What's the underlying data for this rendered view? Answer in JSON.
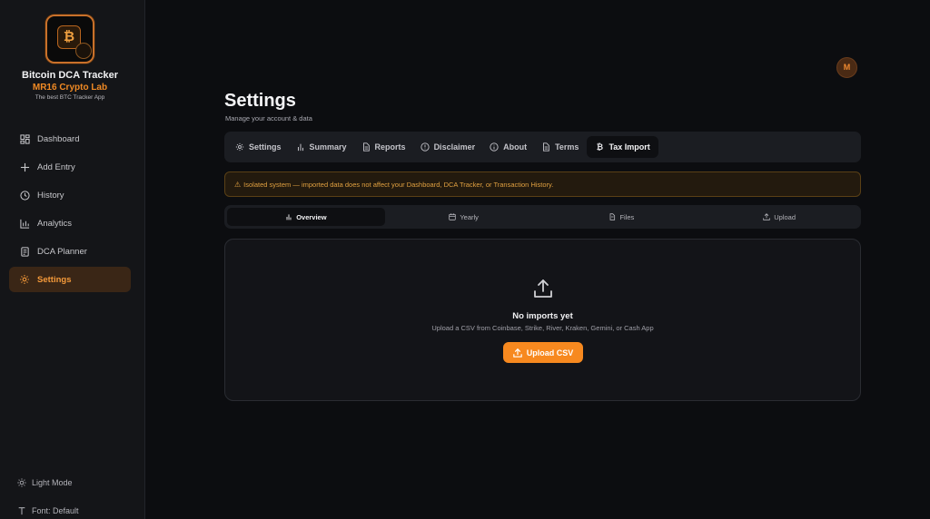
{
  "brand": {
    "title": "Bitcoin DCA Tracker",
    "subtitle": "MR16 Crypto Lab",
    "tagline": "The best BTC Tracker App",
    "accent": "#f7891f"
  },
  "sidebar": {
    "items": [
      {
        "label": "Dashboard",
        "icon": "dashboard-icon"
      },
      {
        "label": "Add Entry",
        "icon": "plus-icon"
      },
      {
        "label": "History",
        "icon": "clock-icon"
      },
      {
        "label": "Analytics",
        "icon": "bar-chart-icon"
      },
      {
        "label": "DCA Planner",
        "icon": "calculator-icon"
      },
      {
        "label": "Settings",
        "icon": "gear-icon",
        "active": true
      }
    ],
    "light_mode": "Light Mode",
    "font": "Font: Default"
  },
  "user": {
    "avatar_initial": "M"
  },
  "header": {
    "title": "Settings",
    "subtitle": "Manage your account & data"
  },
  "tabs": [
    {
      "label": "Settings",
      "icon": "gear-icon"
    },
    {
      "label": "Summary",
      "icon": "bar-chart-icon"
    },
    {
      "label": "Reports",
      "icon": "document-icon"
    },
    {
      "label": "Disclaimer",
      "icon": "alert-circle-icon"
    },
    {
      "label": "About",
      "icon": "info-icon"
    },
    {
      "label": "Terms",
      "icon": "document-icon"
    },
    {
      "label": "Tax Import",
      "icon": "bitcoin-icon",
      "active": true
    }
  ],
  "warning": {
    "text": "Isolated system — imported data does not affect your Dashboard, DCA Tracker, or Transaction History."
  },
  "subtabs": [
    {
      "label": "Overview",
      "icon": "bar-chart-icon",
      "active": true
    },
    {
      "label": "Yearly",
      "icon": "calendar-icon"
    },
    {
      "label": "Files",
      "icon": "document-icon"
    },
    {
      "label": "Upload",
      "icon": "upload-icon"
    }
  ],
  "empty_state": {
    "title": "No imports yet",
    "subtitle": "Upload a CSV from Coinbase, Strike, River, Kraken, Gemini, or Cash App",
    "button": "Upload CSV"
  }
}
